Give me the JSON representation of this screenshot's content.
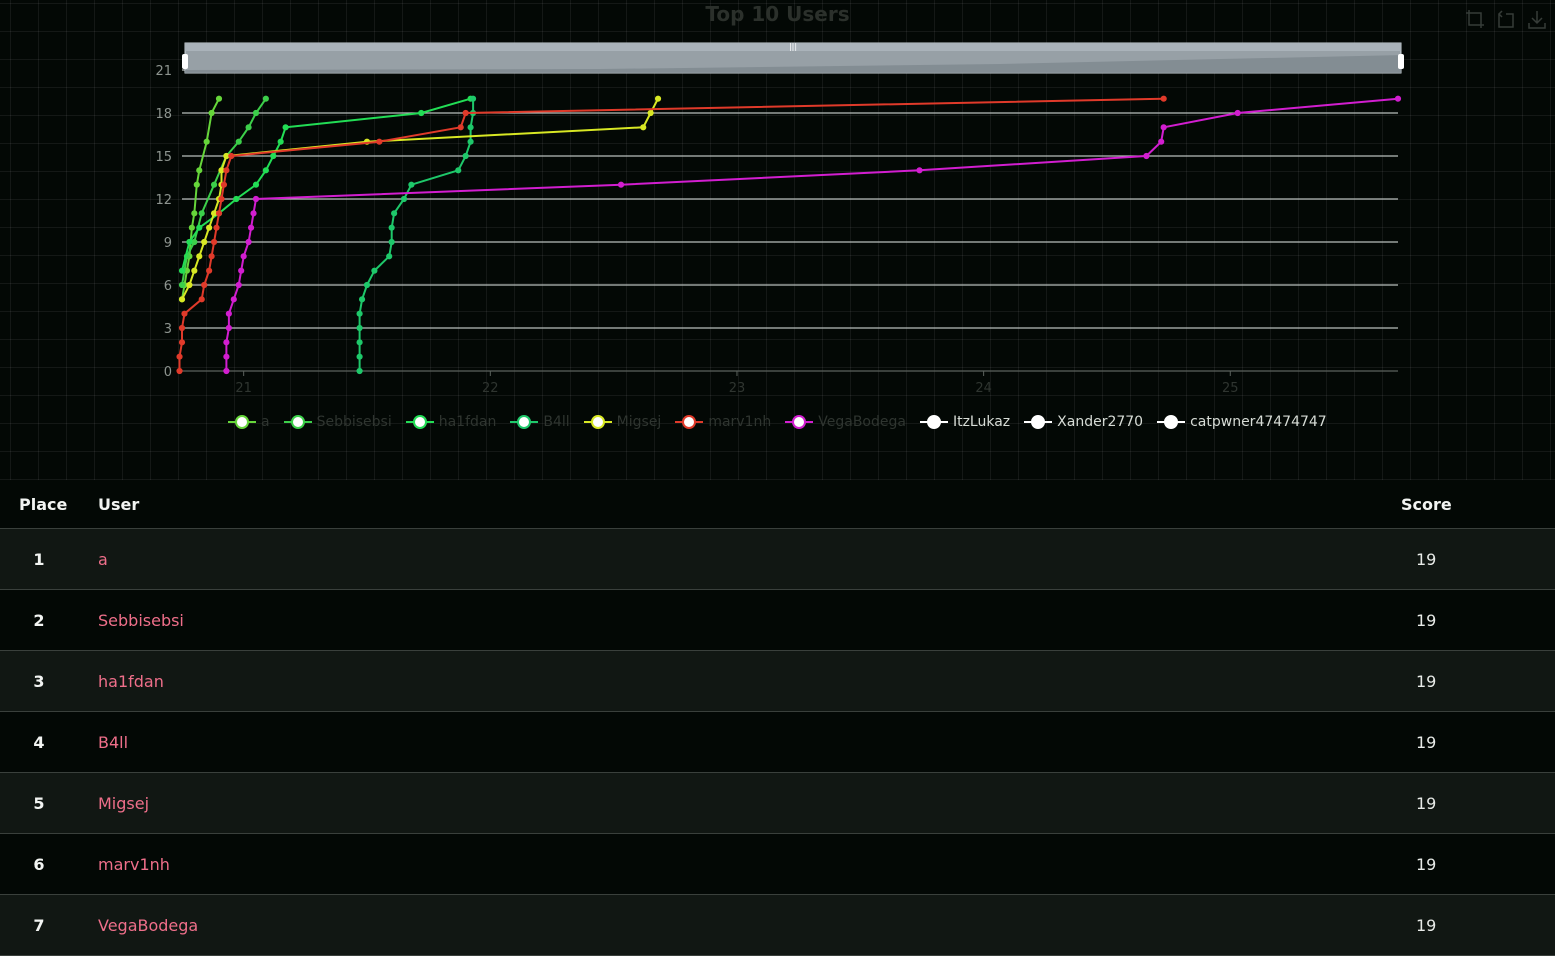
{
  "chart_title": "Top 10 Users",
  "toolbar": {
    "icons": [
      "zoom-icon",
      "reset-zoom-icon",
      "download-icon"
    ]
  },
  "chart_data": {
    "type": "line",
    "title": "Top 10 Users",
    "x_ticks": [
      "21",
      "22",
      "23",
      "24",
      "25"
    ],
    "y_ticks": [
      "0",
      "3",
      "6",
      "9",
      "12",
      "15",
      "18",
      "21"
    ],
    "xlim": [
      20.75,
      25.68
    ],
    "ylim": [
      0,
      21
    ],
    "grid": true,
    "legend_position": "bottom",
    "series": [
      {
        "name": "a",
        "color": "#66d63a",
        "visible": false,
        "points": [
          [
            20.75,
            5
          ],
          [
            20.76,
            6
          ],
          [
            20.77,
            7
          ],
          [
            20.78,
            8
          ],
          [
            20.79,
            10
          ],
          [
            20.8,
            11
          ],
          [
            20.81,
            13
          ],
          [
            20.82,
            14
          ],
          [
            20.85,
            16
          ],
          [
            20.87,
            18
          ],
          [
            20.9,
            19
          ]
        ]
      },
      {
        "name": "Sebbisebsi",
        "color": "#3ccf4a",
        "visible": false,
        "points": [
          [
            20.75,
            6
          ],
          [
            20.77,
            8
          ],
          [
            20.8,
            9
          ],
          [
            20.83,
            11
          ],
          [
            20.88,
            13
          ],
          [
            20.93,
            15
          ],
          [
            20.98,
            16
          ],
          [
            21.02,
            17
          ],
          [
            21.05,
            18
          ],
          [
            21.09,
            19
          ]
        ]
      },
      {
        "name": "ha1fdan",
        "color": "#22dd55",
        "visible": false,
        "points": [
          [
            20.75,
            7
          ],
          [
            20.78,
            9
          ],
          [
            20.82,
            10
          ],
          [
            20.9,
            11
          ],
          [
            20.97,
            12
          ],
          [
            21.05,
            13
          ],
          [
            21.09,
            14
          ],
          [
            21.12,
            15
          ],
          [
            21.15,
            16
          ],
          [
            21.17,
            17
          ],
          [
            21.72,
            18
          ],
          [
            21.92,
            19
          ]
        ]
      },
      {
        "name": "B4ll",
        "color": "#1ec86a",
        "visible": false,
        "points": [
          [
            21.47,
            0
          ],
          [
            21.47,
            1
          ],
          [
            21.47,
            2
          ],
          [
            21.47,
            3
          ],
          [
            21.47,
            4
          ],
          [
            21.48,
            5
          ],
          [
            21.5,
            6
          ],
          [
            21.53,
            7
          ],
          [
            21.59,
            8
          ],
          [
            21.6,
            9
          ],
          [
            21.6,
            10
          ],
          [
            21.61,
            11
          ],
          [
            21.65,
            12
          ],
          [
            21.68,
            13
          ],
          [
            21.87,
            14
          ],
          [
            21.9,
            15
          ],
          [
            21.92,
            16
          ],
          [
            21.92,
            17
          ],
          [
            21.93,
            18
          ],
          [
            21.93,
            19
          ]
        ]
      },
      {
        "name": "Migsej",
        "color": "#d8e824",
        "visible": false,
        "points": [
          [
            20.75,
            5
          ],
          [
            20.78,
            6
          ],
          [
            20.8,
            7
          ],
          [
            20.82,
            8
          ],
          [
            20.84,
            9
          ],
          [
            20.86,
            10
          ],
          [
            20.88,
            11
          ],
          [
            20.9,
            12
          ],
          [
            20.91,
            13
          ],
          [
            20.91,
            14
          ],
          [
            20.93,
            15
          ],
          [
            21.5,
            16
          ],
          [
            22.62,
            17
          ],
          [
            22.65,
            18
          ],
          [
            22.68,
            19
          ]
        ]
      },
      {
        "name": "marv1nh",
        "color": "#e03a2a",
        "visible": false,
        "points": [
          [
            20.74,
            0
          ],
          [
            20.74,
            1
          ],
          [
            20.75,
            2
          ],
          [
            20.75,
            3
          ],
          [
            20.76,
            4
          ],
          [
            20.83,
            5
          ],
          [
            20.84,
            6
          ],
          [
            20.86,
            7
          ],
          [
            20.87,
            8
          ],
          [
            20.88,
            9
          ],
          [
            20.89,
            10
          ],
          [
            20.9,
            11
          ],
          [
            20.91,
            12
          ],
          [
            20.92,
            13
          ],
          [
            20.93,
            14
          ],
          [
            20.95,
            15
          ],
          [
            21.55,
            16
          ],
          [
            21.88,
            17
          ],
          [
            21.9,
            18
          ],
          [
            24.73,
            19
          ]
        ]
      },
      {
        "name": "VegaBodega",
        "color": "#d21ed0",
        "visible": false,
        "points": [
          [
            20.93,
            0
          ],
          [
            20.93,
            1
          ],
          [
            20.93,
            2
          ],
          [
            20.94,
            3
          ],
          [
            20.94,
            4
          ],
          [
            20.96,
            5
          ],
          [
            20.98,
            6
          ],
          [
            20.99,
            7
          ],
          [
            21.0,
            8
          ],
          [
            21.02,
            9
          ],
          [
            21.03,
            10
          ],
          [
            21.04,
            11
          ],
          [
            21.05,
            12
          ],
          [
            22.53,
            13
          ],
          [
            23.74,
            14
          ],
          [
            24.66,
            15
          ],
          [
            24.72,
            16
          ],
          [
            24.73,
            17
          ],
          [
            25.03,
            18
          ],
          [
            25.68,
            19
          ]
        ]
      },
      {
        "name": "ItzLukaz",
        "color": "#ffffff",
        "visible": true,
        "points": []
      },
      {
        "name": "Xander2770",
        "color": "#ffffff",
        "visible": true,
        "points": []
      },
      {
        "name": "catpwner47474747",
        "color": "#ffffff",
        "visible": true,
        "points": []
      }
    ]
  },
  "table": {
    "headers": {
      "place": "Place",
      "user": "User",
      "score": "Score"
    },
    "rows": [
      {
        "place": "1",
        "user": "a",
        "score": "19"
      },
      {
        "place": "2",
        "user": "Sebbisebsi",
        "score": "19"
      },
      {
        "place": "3",
        "user": "ha1fdan",
        "score": "19"
      },
      {
        "place": "4",
        "user": "B4ll",
        "score": "19"
      },
      {
        "place": "5",
        "user": "Migsej",
        "score": "19"
      },
      {
        "place": "6",
        "user": "marv1nh",
        "score": "19"
      },
      {
        "place": "7",
        "user": "VegaBodega",
        "score": "19"
      }
    ]
  }
}
